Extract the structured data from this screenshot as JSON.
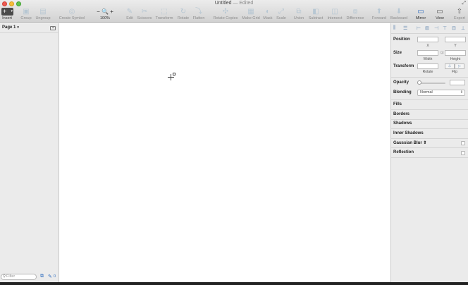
{
  "window": {
    "title": "Untitled",
    "separator": " — ",
    "status": "Edited"
  },
  "toolbar": {
    "insert": {
      "label": "Insert",
      "glyph": "+"
    },
    "items": [
      {
        "label": "Group",
        "icon": "group-icon",
        "glyph": "▣"
      },
      {
        "label": "Ungroup",
        "icon": "ungroup-icon",
        "glyph": "▤"
      },
      {
        "label": "Create Symbol",
        "icon": "create-symbol-icon",
        "glyph": "◎"
      },
      {
        "label": "100%",
        "icon": "zoom-icon",
        "glyph": "− 🔍 +"
      },
      {
        "label": "Edit",
        "icon": "edit-icon",
        "glyph": "✎"
      },
      {
        "label": "Scissors",
        "icon": "scissors-icon",
        "glyph": "✂"
      },
      {
        "label": "Transform",
        "icon": "transform-icon",
        "glyph": "⬚"
      },
      {
        "label": "Rotate",
        "icon": "rotate-icon",
        "glyph": "↻"
      },
      {
        "label": "Flatten",
        "icon": "flatten-icon",
        "glyph": "⤵"
      },
      {
        "label": "Rotate Copies",
        "icon": "rotate-copies-icon",
        "glyph": "✣"
      },
      {
        "label": "Make Grid",
        "icon": "make-grid-icon",
        "glyph": "▦"
      },
      {
        "label": "Mask",
        "icon": "mask-icon",
        "glyph": "◐"
      },
      {
        "label": "Scale",
        "icon": "scale-icon",
        "glyph": "⤢"
      },
      {
        "label": "Union",
        "icon": "union-icon",
        "glyph": "⧉"
      },
      {
        "label": "Subtract",
        "icon": "subtract-icon",
        "glyph": "◧"
      },
      {
        "label": "Intersect",
        "icon": "intersect-icon",
        "glyph": "◫"
      },
      {
        "label": "Difference",
        "icon": "difference-icon",
        "glyph": "⧈"
      },
      {
        "label": "Forward",
        "icon": "forward-icon",
        "glyph": "⬆"
      },
      {
        "label": "Backward",
        "icon": "backward-icon",
        "glyph": "⬇"
      },
      {
        "label": "Mirror",
        "icon": "mirror-icon",
        "glyph": "▭"
      },
      {
        "label": "View",
        "icon": "view-icon",
        "glyph": "▭"
      },
      {
        "label": "Export",
        "icon": "export-icon",
        "glyph": "⇧"
      }
    ]
  },
  "sidebar": {
    "page_label": "Page 1",
    "filter_placeholder": "Filter",
    "edit_count": "0"
  },
  "inspector": {
    "position_label": "Position",
    "x_label": "X",
    "y_label": "Y",
    "size_label": "Size",
    "width_label": "Width",
    "height_label": "Height",
    "transform_label": "Transform",
    "rotate_label": "Rotate",
    "flip_label": "Flip",
    "opacity_label": "Opacity",
    "blending_label": "Blending",
    "blending_value": "Normal",
    "sections": [
      "Fills",
      "Borders",
      "Shadows",
      "Inner Shadows",
      "Gaussian Blur",
      "Reflection"
    ]
  },
  "colors": {
    "toolbar_bg": "#d9d9d9",
    "sidebar_bg": "#ebebeb",
    "canvas_bg": "#ffffff",
    "accent": "#2f6dbf",
    "disabled_icon": "#b7c7d3"
  }
}
